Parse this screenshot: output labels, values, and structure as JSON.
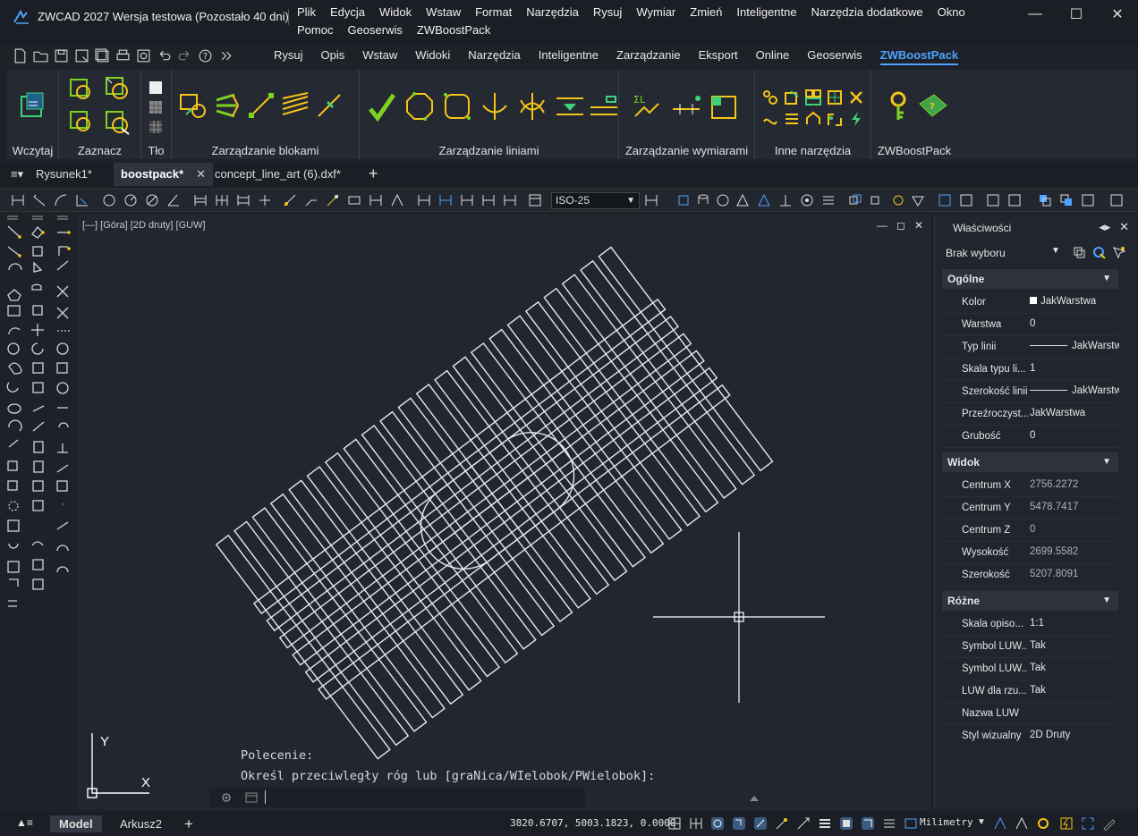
{
  "window": {
    "title": "ZWCAD 2027 Wersja testowa (Pozostało 40 dni)",
    "minimize": "—",
    "maximize": "☐",
    "close": "✕"
  },
  "menu": [
    "Plik",
    "Edycja",
    "Widok",
    "Wstaw",
    "Format",
    "Narzędzia",
    "Rysuj",
    "Wymiar",
    "Zmień",
    "Inteligentne",
    "Narzędzia dodatkowe",
    "Okno",
    "Pomoc",
    "Geoserwis",
    "ZWBoostPack"
  ],
  "ribbon_tabs": [
    "Rysuj",
    "Opis",
    "Wstaw",
    "Widoki",
    "Narzędzia",
    "Inteligentne",
    "Zarządzanie",
    "Eksport",
    "Online",
    "Geoserwis",
    "ZWBoostPack"
  ],
  "ribbon_active_tab": "ZWBoostPack",
  "ribbon_groups": [
    "Wczytaj",
    "Zaznacz",
    "Tło",
    "Zarządzanie blokami",
    "Zarządzanie liniami",
    "Zarządzanie wymiarami",
    "Inne narzędzia",
    "ZWBoostPack"
  ],
  "doc_tabs": [
    "Rysunek1*",
    "boostpack*",
    "concept_line_art (6).dxf*"
  ],
  "doc_tab_close": "✕",
  "add_tab": "+",
  "dimstyle": "ISO-25",
  "viewport": {
    "label": "[—] [Góra] [2D druty] [GUW]",
    "ctrl_min": "—",
    "ctrl_max": "◻",
    "ctrl_close": "✕",
    "ucs_x": "X",
    "ucs_y": "Y"
  },
  "command": {
    "line1": "Polecenie:",
    "line2": "Określ przeciwległy róg lub [graNica/WIelobok/PWielobok]:"
  },
  "properties": {
    "title": "Właściwości",
    "selection": "Brak wyboru",
    "sections": {
      "general": {
        "title": "Ogólne",
        "rows": [
          {
            "key": "Kolor",
            "value": "JakWarstwa"
          },
          {
            "key": "Warstwa",
            "value": "0"
          },
          {
            "key": "Typ linii",
            "value": "JakWarstwa"
          },
          {
            "key": "Skala typu li...",
            "value": "1"
          },
          {
            "key": "Szerokość linii",
            "value": "JakWarstwa"
          },
          {
            "key": "Przeźroczyst...",
            "value": "JakWarstwa"
          },
          {
            "key": "Grubość",
            "value": "0"
          }
        ]
      },
      "view": {
        "title": "Widok",
        "rows": [
          {
            "key": "Centrum X",
            "value": "2756.2272"
          },
          {
            "key": "Centrum Y",
            "value": "5478.7417"
          },
          {
            "key": "Centrum Z",
            "value": "0"
          },
          {
            "key": "Wysokość",
            "value": "2699.5582"
          },
          {
            "key": "Szerokość",
            "value": "5207.8091"
          }
        ]
      },
      "misc": {
        "title": "Różne",
        "rows": [
          {
            "key": "Skala opiso...",
            "value": "1:1"
          },
          {
            "key": "Symbol LUW...",
            "value": "Tak"
          },
          {
            "key": "Symbol LUW...",
            "value": "Tak"
          },
          {
            "key": "LUW dla rzu...",
            "value": "Tak"
          },
          {
            "key": "Nazwa LUW",
            "value": ""
          },
          {
            "key": "Styl wizualny",
            "value": "2D Druty"
          }
        ]
      }
    }
  },
  "status": {
    "tab_model": "Model",
    "tab_sheet": "Arkusz2",
    "add": "+",
    "coords": "3820.6707, 5003.1823, 0.0000",
    "units": "Milimetry"
  }
}
